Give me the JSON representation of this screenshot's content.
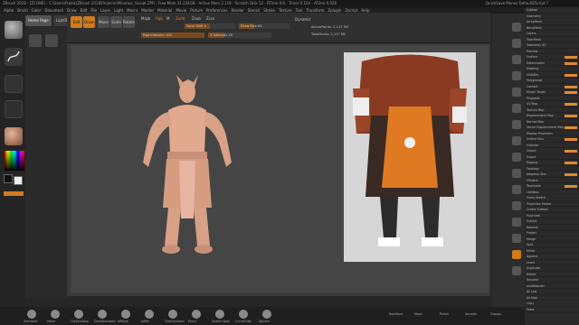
{
  "window": {
    "title": "ZBrush 2018 - [ZCONE] - C:\\Users\\Public\\ZBrush 2018\\Projects\\Minotaur_Sculpt.ZPR - Free Mem 31.234GB - Active Mem 2.119 - Scratch Disk 12 - RTime 0.6 - Timer 0.104 - ATime 0.026",
    "right_status": "QuickSave  Menus  DefaultZScript  ?"
  },
  "menubar": {
    "items": [
      "Alpha",
      "Brush",
      "Color",
      "Document",
      "Draw",
      "Edit",
      "File",
      "Layer",
      "Light",
      "Macro",
      "Marker",
      "Material",
      "Movie",
      "Picture",
      "Preferences",
      "Render",
      "Stencil",
      "Stroke",
      "Texture",
      "Tool",
      "Transform",
      "Zplugin",
      "Zscript",
      "Help"
    ]
  },
  "tabs": [
    "Home Page",
    "LightBox",
    "Live Boolean"
  ],
  "toolbar": {
    "buttons": [
      "Edit",
      "Draw",
      "Move",
      "Scale",
      "Rotate"
    ],
    "labels": {
      "mrgb": "Mrgb",
      "rgb": "Rgb",
      "m": "M",
      "zadd": "Zadd",
      "zsub": "Zsub",
      "zcut": "Zcut"
    },
    "sliders": [
      {
        "label": "Focal Shift 0",
        "fill": 0.5
      },
      {
        "label": "Draw Size 64",
        "fill": 0.3
      },
      {
        "label": "Rgb Intensity 100",
        "fill": 1.0
      },
      {
        "label": "Z Intensity 25",
        "fill": 0.25
      }
    ],
    "info": [
      "ActivePoints: 2,117 Mil",
      "TotalPoints: 2,117 Mil"
    ],
    "dynamic": "Dynamic"
  },
  "lefttray": {
    "labels": [
      "Standard",
      "Dots",
      "Alpha Off",
      "Texture Off",
      "BasicMaterial"
    ],
    "gradient": "Gradient",
    "switch_color": "SwitchColor"
  },
  "right_shelf": {
    "labels": [
      "BPR",
      "SPix 3",
      "Scroll",
      "Zoom",
      "Actual",
      "AAHalf",
      "Persp",
      "Floor",
      "Local",
      "Frame",
      "Move",
      "Zoom3D",
      "Rotate",
      "Transp",
      "Solo",
      "Xpose"
    ]
  },
  "tray3": {
    "rows": [
      "Subtool",
      "Geometry",
      "ArrayMesh",
      "NanoMesh",
      "Layers",
      "FiberMesh",
      "Geometry HD",
      "Preview",
      "Surface",
      "Deformation",
      "Masking",
      "Visibility",
      "Polygroups",
      "Contact",
      "Morph Target",
      "Polypaint",
      "UV Map",
      "Texture Map",
      "Displacement Map",
      "Normal Map",
      "Vector Displacement Map",
      "Display Properties",
      "Unified Skin",
      "Initialize",
      "Import",
      "Export",
      "Rigging",
      "Topology",
      "Adaptive Skin",
      "ZSketch",
      "Tessimate",
      "Lightbox",
      "Quick Sketch",
      "Projection Master",
      "Create Subtool",
      "Polymesh",
      "Extract",
      "Remesh",
      "Project",
      "Merge",
      "Split",
      "Mirror",
      "Append",
      "Insert",
      "Duplicate",
      "Delete",
      "Rename",
      "AutoReorder",
      "All Low",
      "All High",
      "Copy",
      "Paste"
    ],
    "bars": [
      8,
      9,
      11,
      13,
      14,
      16,
      18,
      20,
      22,
      24,
      26,
      28,
      30
    ]
  },
  "bottombar": {
    "items": [
      "Standard",
      "Move",
      "ClayBuildup",
      "DamStandard",
      "hPolish",
      "Inflat",
      "TrimDynamic",
      "Pinch",
      "Snake Hook",
      "CurveTube",
      "Sphere"
    ],
    "right": [
      "Backface",
      "Mask",
      "Polish",
      "Smooth",
      "Groups"
    ]
  },
  "colors": {
    "accent": "#d27a1e",
    "skin": "#e1a98d",
    "reference_bg": "#d6d6d6"
  }
}
